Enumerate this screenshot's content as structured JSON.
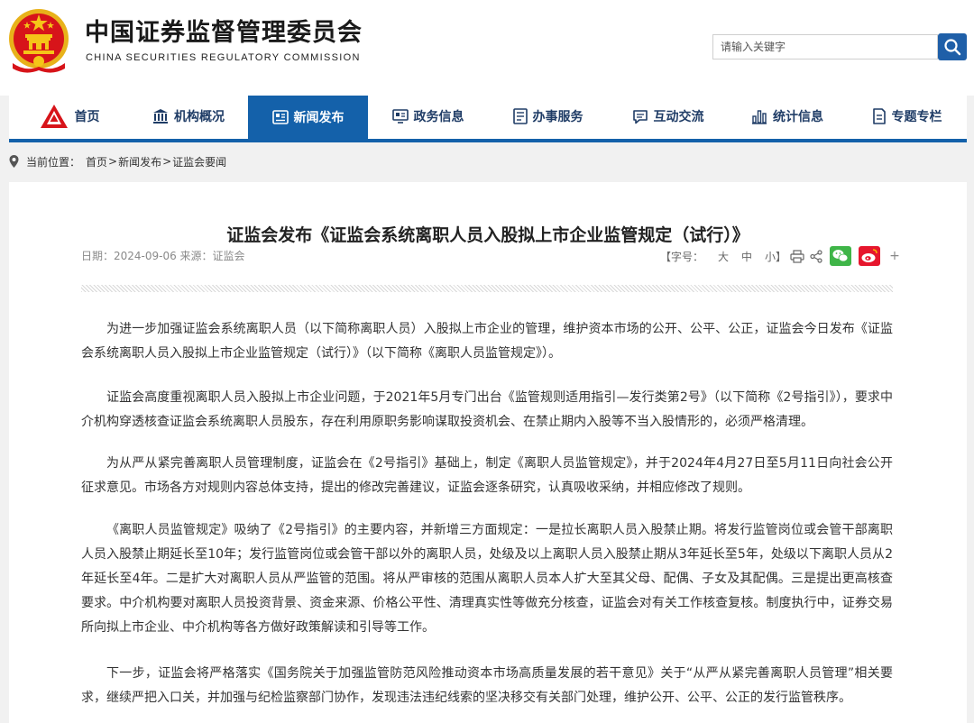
{
  "header": {
    "site_name_cn": "中国证券监督管理委员会",
    "site_name_en": "CHINA SECURITIES REGULATORY COMMISSION",
    "search_placeholder": "请输入关键字",
    "search_icon": "search-icon",
    "emblem_icon": "national-emblem-icon"
  },
  "nav": {
    "items": [
      {
        "label": "首页",
        "icon": "csrc-logo-icon"
      },
      {
        "label": "机构概况",
        "icon": "building-icon"
      },
      {
        "label": "新闻发布",
        "icon": "newspaper-icon",
        "active": true
      },
      {
        "label": "政务信息",
        "icon": "monitor-icon"
      },
      {
        "label": "办事服务",
        "icon": "document-list-icon"
      },
      {
        "label": "互动交流",
        "icon": "chat-icon"
      },
      {
        "label": "统计信息",
        "icon": "bar-chart-icon"
      },
      {
        "label": "专题专栏",
        "icon": "document-icon"
      }
    ]
  },
  "breadcrumb": {
    "prefix": "当前位置：",
    "items": [
      "首页",
      "新闻发布",
      "证监会要闻"
    ],
    "separator": ">"
  },
  "article": {
    "title": "证监会发布《证监会系统离职人员入股拟上市企业监管规定（试行）》",
    "meta": "日期：2024-09-06 来源：证监会",
    "tools": {
      "font_size_label": "【字号：",
      "size_large": "大",
      "size_medium": "中",
      "size_small": "小】",
      "plus": "+"
    },
    "paragraphs": [
      "为进一步加强证监会系统离职人员（以下简称离职人员）入股拟上市企业的管理，维护资本市场的公开、公平、公正，证监会今日发布《证监会系统离职人员入股拟上市企业监管规定（试行）》（以下简称《离职人员监管规定》）。",
      "证监会高度重视离职人员入股拟上市企业问题，于2021年5月专门出台《监管规则适用指引—发行类第2号》（以下简称《2号指引》），要求中介机构穿透核查证监会系统离职人员股东，存在利用原职务影响谋取投资机会、在禁止期内入股等不当入股情形的，必须严格清理。",
      "为从严从紧完善离职人员管理制度，证监会在《2号指引》基础上，制定《离职人员监管规定》，并于2024年4月27日至5月11日向社会公开征求意见。市场各方对规则内容总体支持，提出的修改完善建议，证监会逐条研究，认真吸收采纳，并相应修改了规则。",
      "《离职人员监管规定》吸纳了《2号指引》的主要内容，并新增三方面规定：一是拉长离职人员入股禁止期。将发行监管岗位或会管干部离职人员入股禁止期延长至10年；发行监管岗位或会管干部以外的离职人员，处级及以上离职人员入股禁止期从3年延长至5年，处级以下离职人员从2年延长至4年。二是扩大对离职人员从严监管的范围。将从严审核的范围从离职人员本人扩大至其父母、配偶、子女及其配偶。三是提出更高核查要求。中介机构要对离职人员投资背景、资金来源、价格公平性、清理真实性等做充分核查，证监会对有关工作核查复核。制度执行中，证券交易所向拟上市企业、中介机构等各方做好政策解读和引导等工作。",
      "下一步，证监会将严格落实《国务院关于加强监管防范风险推动资本市场高质量发展的若干意见》关于“从严从紧完善离职人员管理”相关要求，继续严把入口关，并加强与纪检监察部门协作，发现违法违纪线索的坚决移交有关部门处理，维护公开、公平、公正的发行监管秩序。"
    ]
  },
  "colors": {
    "nav_active": "#1461aa",
    "nav_text": "#1f3c66",
    "search_button": "#1f5fa8",
    "emblem_red": "#d7141a",
    "emblem_gold": "#f5c518",
    "wechat_green": "#3fb548",
    "weibo_red": "#e6162d"
  }
}
